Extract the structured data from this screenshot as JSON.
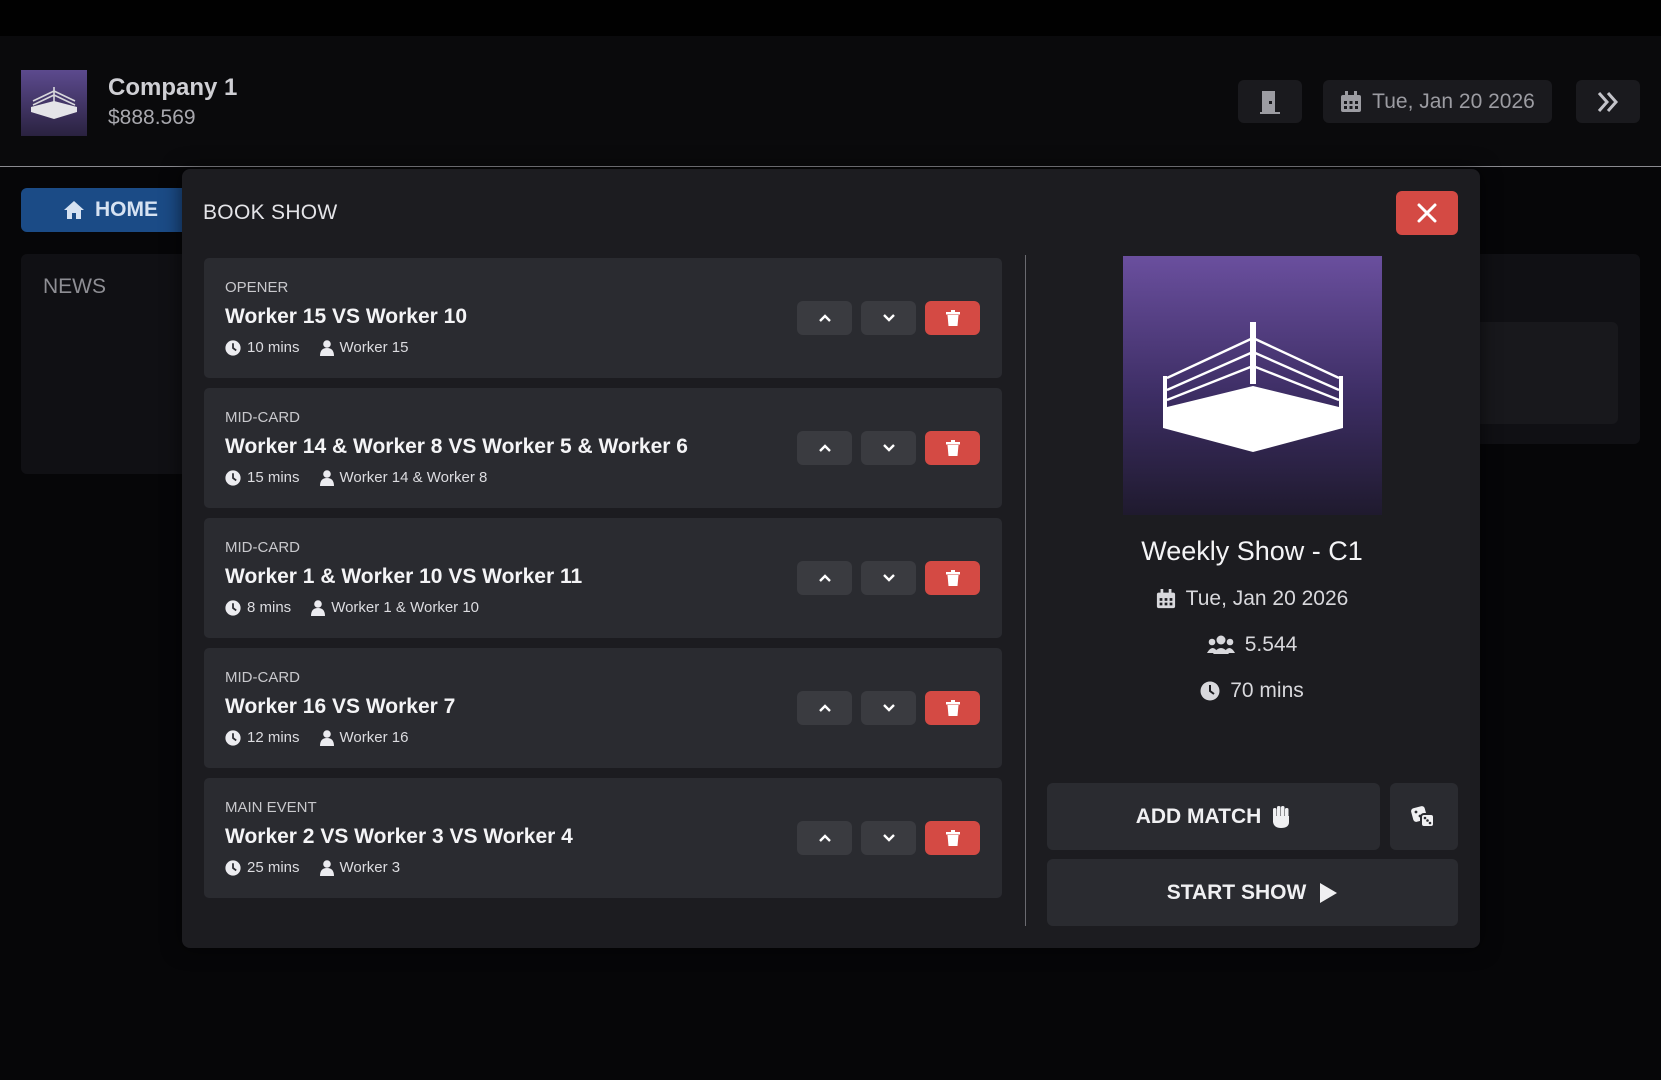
{
  "header": {
    "company_name": "Company 1",
    "money": "$888.569",
    "date": "Tue, Jan 20 2026",
    "icons": [
      "ring-logo-icon",
      "door-icon",
      "calendar-icon",
      "double-chevron-right-icon"
    ]
  },
  "nav": {
    "home_label": "HOME",
    "news_label": "NEWS"
  },
  "modal": {
    "title": "BOOK SHOW",
    "matches": [
      {
        "type": "OPENER",
        "title": "Worker 15 VS Worker 10",
        "duration": "10 mins",
        "winner": "Worker 15"
      },
      {
        "type": "MID-CARD",
        "title": "Worker 14 & Worker 8 VS Worker 5 & Worker 6",
        "duration": "15 mins",
        "winner": "Worker 14 & Worker 8"
      },
      {
        "type": "MID-CARD",
        "title": "Worker 1 & Worker 10 VS Worker 11",
        "duration": "8 mins",
        "winner": "Worker 1 & Worker 10"
      },
      {
        "type": "MID-CARD",
        "title": "Worker 16 VS Worker 7",
        "duration": "12 mins",
        "winner": "Worker 16"
      },
      {
        "type": "MAIN EVENT",
        "title": "Worker 2 VS Worker 3 VS Worker 4",
        "duration": "25 mins",
        "winner": "Worker 3"
      }
    ],
    "show": {
      "name": "Weekly Show - C1",
      "date": "Tue, Jan 20 2026",
      "attendance": "5.544",
      "duration": "70 mins"
    },
    "add_match_label": "ADD MATCH",
    "start_show_label": "START SHOW"
  },
  "colors": {
    "accent_red": "#d44a44",
    "home_blue": "#1b4b86",
    "card_bg": "#2a2b30",
    "modal_bg": "#1c1c20",
    "show_art_purple": "#6a4f9e"
  }
}
